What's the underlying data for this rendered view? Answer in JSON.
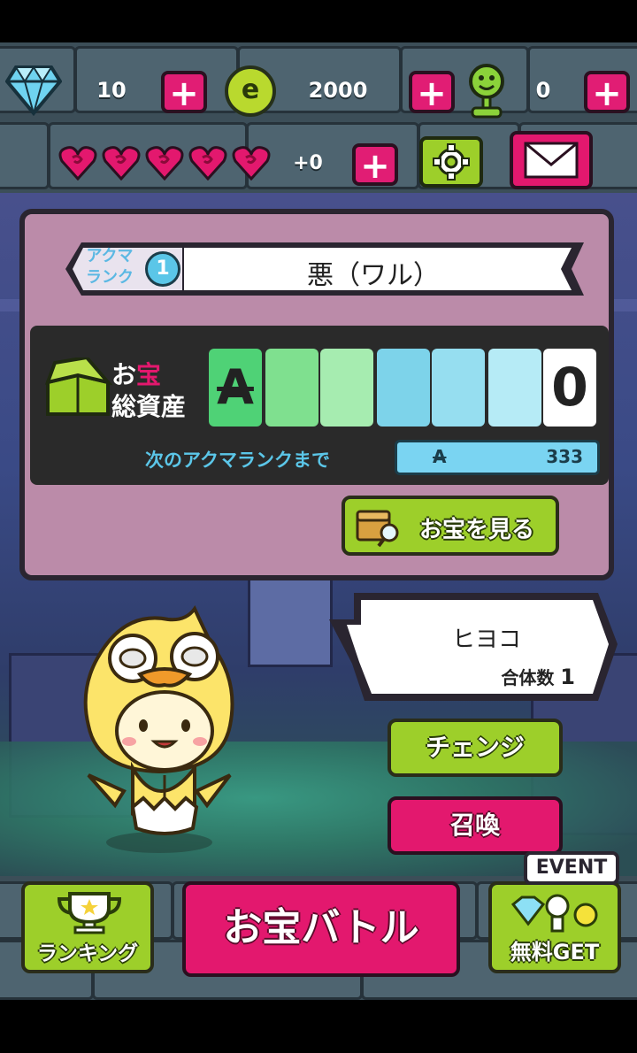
{
  "currency": {
    "diamonds": "10",
    "coins": "2000",
    "friends": "0",
    "coin_symbol": "e"
  },
  "stamina": {
    "hearts_count": 5,
    "bonus": "+0"
  },
  "panel": {
    "rank_label_line1": "アクマ",
    "rank_label_line2": "ランク",
    "rank_number": "1",
    "rank_name": "悪（ワル）",
    "assets_label_line1_a": "お",
    "assets_label_line1_b": "宝",
    "assets_label_line2": "総資産",
    "assets_currency_symbol": "A",
    "assets_value": "0",
    "next_rank_label": "次のアクマランクまで",
    "next_rank_symbol": "A",
    "next_rank_value": "333",
    "view_treasure_button": "お宝を見る"
  },
  "character": {
    "name": "ヒヨコ",
    "fusion_label": "合体数",
    "fusion_count": "1"
  },
  "actions": {
    "change_button": "チェンジ",
    "summon_button": "召喚"
  },
  "bottom": {
    "ranking_button": "ランキング",
    "battle_button": "お宝バトル",
    "free_get_button": "無料GET",
    "event_badge": "EVENT"
  },
  "colors": {
    "magenta": "#e3186e",
    "green": "#9dcf2a",
    "panel_pink": "#bb8ba9",
    "cyan": "#5bc6e8"
  }
}
